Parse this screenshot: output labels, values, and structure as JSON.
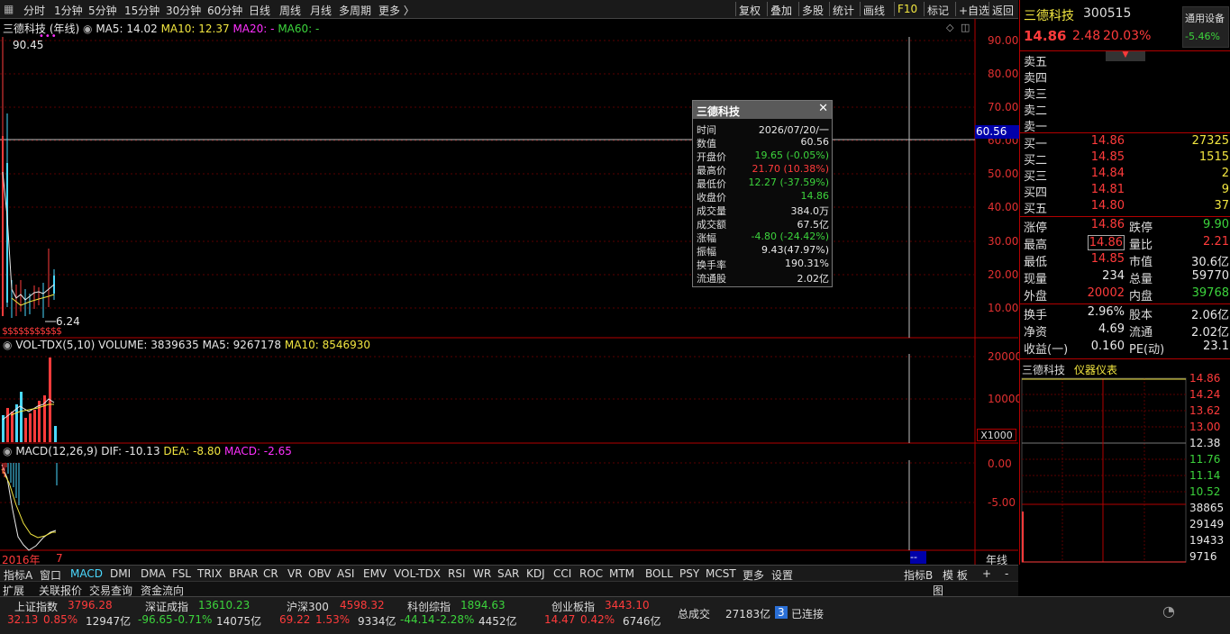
{
  "toolbar": {
    "periods": [
      "分时",
      "1分钟",
      "5分钟",
      "15分钟",
      "30分钟",
      "60分钟",
      "日线",
      "周线",
      "月线",
      "多周期",
      "更多 〉"
    ],
    "actions": [
      "复权",
      "叠加",
      "多股",
      "统计",
      "画线",
      "F10",
      "标记",
      "+自选",
      "返回"
    ]
  },
  "main_chart": {
    "title": "三德科技 (年线)",
    "ma5": "MA5: 14.02",
    "ma10": "MA10: 12.37",
    "ma20": "MA20: -",
    "ma60": "MA60: -",
    "high_label": "90.45",
    "low_label": "6.24",
    "crosshair_value": "60.56",
    "ticks": [
      "90.00",
      "80.00",
      "70.00",
      "60.00",
      "50.00",
      "40.00",
      "30.00",
      "20.00",
      "10.00"
    ],
    "sss": "$$$$$$$$$$$"
  },
  "volume_chart": {
    "title": "VOL-TDX(5,10)",
    "volume": "VOLUME: 3839635",
    "ma5": "MA5: 9267178",
    "ma10": "MA10: 8546930",
    "ticks": [
      "20000",
      "10000"
    ],
    "unit": "X1000"
  },
  "macd_chart": {
    "title": "MACD(12,26,9)",
    "dif": "DIF: -10.13",
    "dea": "DEA: -8.80",
    "macd": "MACD: -2.65",
    "ticks": [
      "0.00",
      "-5.00"
    ],
    "year_label": "2016年",
    "seven": "7",
    "dashes": "--",
    "period_label": "年线"
  },
  "tooltip": {
    "name": "三德科技",
    "rows": [
      {
        "label": "时间",
        "value": "2026/07/20/一",
        "color": "#e8e8e8"
      },
      {
        "label": "数值",
        "value": "60.56",
        "color": "#e8e8e8"
      },
      {
        "label": "开盘价",
        "value": "19.65 (-0.05%)",
        "color": "#3cd43c"
      },
      {
        "label": "最高价",
        "value": "21.70 (10.38%)",
        "color": "#ff3b3b"
      },
      {
        "label": "最低价",
        "value": "12.27 (-37.59%)",
        "color": "#3cd43c"
      },
      {
        "label": "收盘价",
        "value": "14.86",
        "color": "#3cd43c"
      },
      {
        "label": "成交量",
        "value": "384.0万",
        "color": "#e8e8e8"
      },
      {
        "label": "成交额",
        "value": "67.5亿",
        "color": "#e8e8e8"
      },
      {
        "label": "涨幅",
        "value": "-4.80 (-24.42%)",
        "color": "#3cd43c"
      },
      {
        "label": "振幅",
        "value": "9.43(47.97%)",
        "color": "#e8e8e8"
      },
      {
        "label": "换手率",
        "value": "190.31%",
        "color": "#e8e8e8"
      },
      {
        "label": "流通股",
        "value": "2.02亿",
        "color": "#e8e8e8"
      }
    ]
  },
  "quote": {
    "name": "三德科技",
    "code": "300515",
    "category": "通用设备",
    "category_change": "-5.46%",
    "price": "14.86",
    "change": "2.48",
    "change_pct": "20.03%",
    "sells": [
      "卖五",
      "卖四",
      "卖三",
      "卖二",
      "卖一"
    ],
    "buys": [
      {
        "label": "买一",
        "price": "14.86",
        "vol": "27325"
      },
      {
        "label": "买二",
        "price": "14.85",
        "vol": "1515"
      },
      {
        "label": "买三",
        "price": "14.84",
        "vol": "2"
      },
      {
        "label": "买四",
        "price": "14.81",
        "vol": "9"
      },
      {
        "label": "买五",
        "price": "14.80",
        "vol": "37"
      }
    ],
    "stats1": [
      {
        "l1": "涨停",
        "v1": "14.86",
        "c1": "#ff3b3b",
        "l2": "跌停",
        "v2": "9.90",
        "c2": "#3cd43c"
      },
      {
        "l1": "最高",
        "v1": "14.86",
        "c1": "#ff3b3b",
        "l2": "量比",
        "v2": "2.21",
        "c2": "#ff3b3b"
      },
      {
        "l1": "最低",
        "v1": "14.85",
        "c1": "#ff3b3b",
        "l2": "市值",
        "v2": "30.6亿",
        "c2": "#e8e8e8"
      },
      {
        "l1": "现量",
        "v1": "234",
        "c1": "#e8e8e8",
        "l2": "总量",
        "v2": "59770",
        "c2": "#e8e8e8"
      },
      {
        "l1": "外盘",
        "v1": "20002",
        "c1": "#ff3b3b",
        "l2": "内盘",
        "v2": "39768",
        "c2": "#3cd43c"
      }
    ],
    "stats2": [
      {
        "l1": "换手",
        "v1": "2.96%",
        "l2": "股本",
        "v2": "2.06亿"
      },
      {
        "l1": "净资",
        "v1": "4.69",
        "l2": "流通",
        "v2": "2.02亿"
      },
      {
        "l1": "收益(一)",
        "v1": "0.160",
        "l2": "PE(动)",
        "v2": "23.1"
      }
    ],
    "mini_title": "三德科技",
    "mini_subtitle": "仪器仪表",
    "mini_ticks": [
      {
        "v": "14.86",
        "c": "#ff3b3b"
      },
      {
        "v": "14.24",
        "c": "#ff3b3b"
      },
      {
        "v": "13.62",
        "c": "#ff3b3b"
      },
      {
        "v": "13.00",
        "c": "#ff3b3b"
      },
      {
        "v": "12.38",
        "c": "#e8e8e8"
      },
      {
        "v": "11.76",
        "c": "#3cd43c"
      },
      {
        "v": "11.14",
        "c": "#3cd43c"
      },
      {
        "v": "10.52",
        "c": "#3cd43c"
      },
      {
        "v": "38865",
        "c": "#e8e8e8"
      },
      {
        "v": "29149",
        "c": "#e8e8e8"
      },
      {
        "v": "19433",
        "c": "#e8e8e8"
      },
      {
        "v": "9716",
        "c": "#e8e8e8"
      }
    ]
  },
  "tabs": [
    "指标A",
    "窗口",
    "MACD",
    "DMI",
    "DMA",
    "FSL",
    "TRIX",
    "BRAR",
    "CR",
    "VR",
    "OBV",
    "ASI",
    "EMV",
    "VOL-TDX",
    "RSI",
    "WR",
    "SAR",
    "KDJ",
    "CCI",
    "ROC",
    "MTM",
    "BOLL",
    "PSY",
    "MCST",
    "更多",
    "设置"
  ],
  "tabs_right": [
    "指标B",
    "模 板",
    "+",
    "-"
  ],
  "ext": [
    "扩展",
    "关联报价",
    "交易查询",
    "资金流向"
  ],
  "ext_right": "图",
  "indices": [
    {
      "name": "上证指数",
      "value": "3796.28",
      "chg": "32.13",
      "pct": "0.85%",
      "amt": "12947亿",
      "color": "#ff3b3b"
    },
    {
      "name": "深证成指",
      "value": "13610.23",
      "chg": "-96.65",
      "pct": "-0.71%",
      "amt": "14075亿",
      "color": "#3cd43c"
    },
    {
      "name": "沪深300",
      "value": "4598.32",
      "chg": "69.22",
      "pct": "1.53%",
      "amt": "9334亿",
      "color": "#ff3b3b"
    },
    {
      "name": "科创综指",
      "value": "1894.63",
      "chg": "-44.14",
      "pct": "-2.28%",
      "amt": "4452亿",
      "color": "#3cd43c"
    },
    {
      "name": "创业板指",
      "value": "3443.10",
      "chg": "14.47",
      "pct": "0.42%",
      "amt": "6746亿",
      "color": "#ff3b3b"
    }
  ],
  "total_label": "总成交",
  "total_value": "27183亿",
  "conn_num": "3",
  "conn_text": "已连接"
}
